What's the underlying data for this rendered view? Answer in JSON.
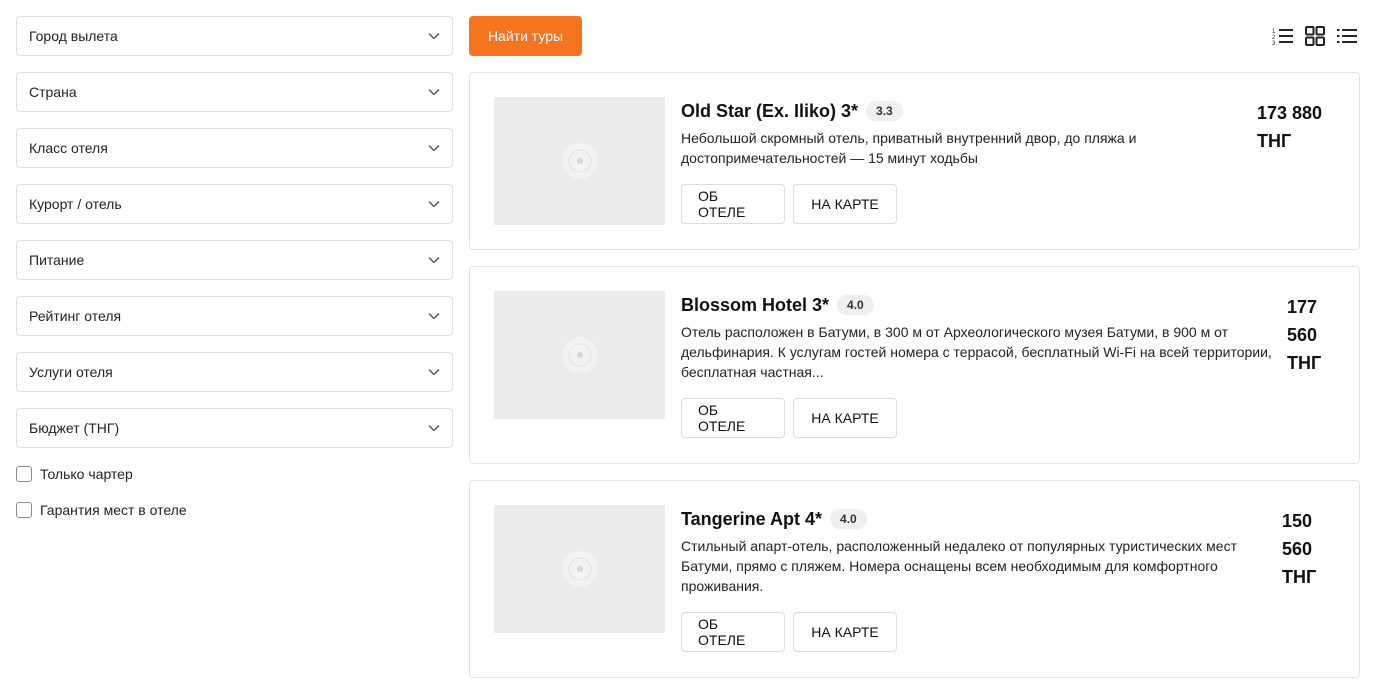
{
  "filters": {
    "selects": [
      {
        "label": "Город вылета"
      },
      {
        "label": "Страна"
      },
      {
        "label": "Класс отеля"
      },
      {
        "label": "Курорт / отель"
      },
      {
        "label": "Питание"
      },
      {
        "label": "Рейтинг отеля"
      },
      {
        "label": "Услуги отеля"
      },
      {
        "label": "Бюджет (ТНГ)"
      }
    ],
    "checkboxes": [
      {
        "label": "Только чартер",
        "checked": false
      },
      {
        "label": "Гарантия мест в отеле",
        "checked": false
      }
    ]
  },
  "toolbar": {
    "search_button": "Найти туры",
    "view_icons": [
      "numbered-list-icon",
      "grid-icon",
      "list-icon"
    ]
  },
  "hotels": [
    {
      "name": "Old Star (Ex. Iliko) 3*",
      "rating": "3.3",
      "description": "Небольшой скромный отель, приватный внутренний двор, до пляжа и достопримечательностей — 15 минут ходьбы",
      "price": "173 880 ТНГ",
      "about_label": "ОБ ОТЕЛЕ",
      "map_label": "НА КАРТЕ"
    },
    {
      "name": "Blossom Hotel 3*",
      "rating": "4.0",
      "description": "Отель расположен в Батуми, в 300 м от Археологического музея Батуми, в 900 м от дельфинария. К услугам гостей номера с террасой, бесплатный Wi-Fi на всей территории, бесплатная частная...",
      "price": "177 560 ТНГ",
      "about_label": "ОБ ОТЕЛЕ",
      "map_label": "НА КАРТЕ"
    },
    {
      "name": "Tangerine Apt 4*",
      "rating": "4.0",
      "description": "Стильный апарт-отель, расположенный недалеко от популярных туристических мест Батуми, прямо с пляжем. Номера оснащены всем необходимым для комфортного проживания.",
      "price": "150 560 ТНГ",
      "about_label": "ОБ ОТЕЛЕ",
      "map_label": "НА КАРТЕ"
    }
  ],
  "colors": {
    "accent": "#f5741f",
    "border": "#dedede",
    "thumb_bg": "#ebebeb",
    "rating_bg": "#efefef"
  }
}
